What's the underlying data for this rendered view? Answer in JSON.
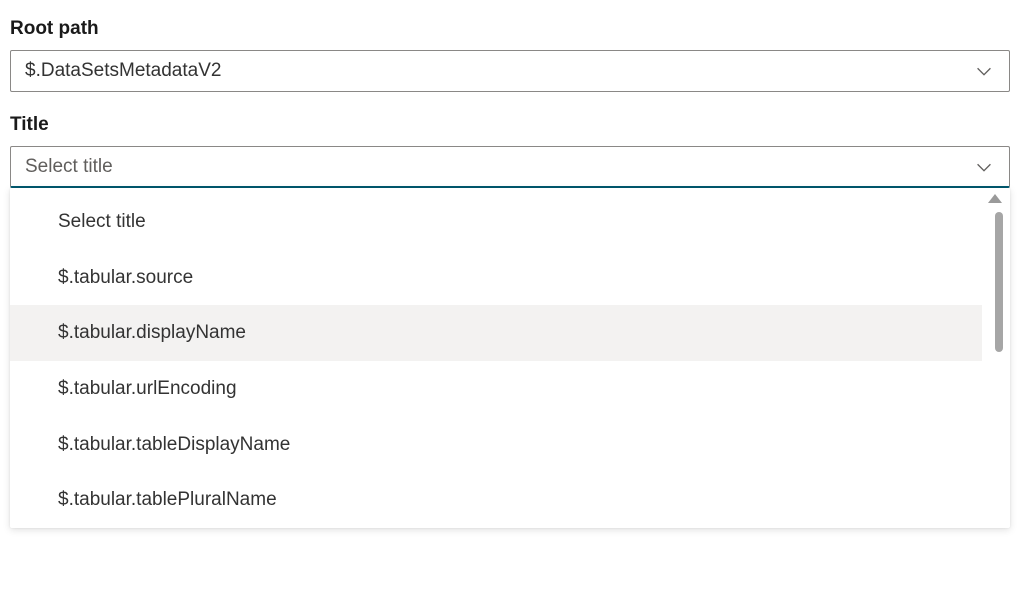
{
  "rootPath": {
    "label": "Root path",
    "value": "$.DataSetsMetadataV2"
  },
  "title": {
    "label": "Title",
    "placeholder": "Select title",
    "options": [
      "Select title",
      "$.tabular.source",
      "$.tabular.displayName",
      "$.tabular.urlEncoding",
      "$.tabular.tableDisplayName",
      "$.tabular.tablePluralName"
    ],
    "hoveredIndex": 2
  }
}
